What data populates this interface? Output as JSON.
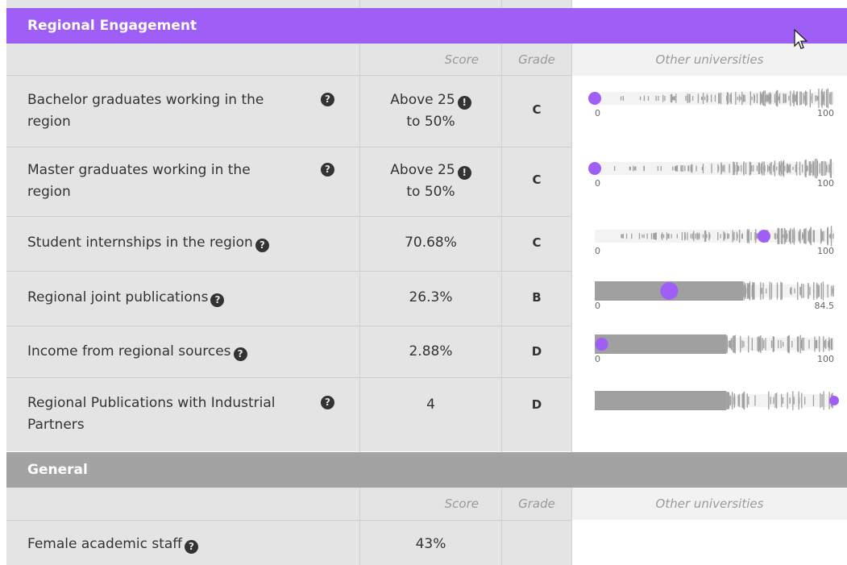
{
  "sections": {
    "regional": {
      "title": "Regional Engagement",
      "columns": {
        "score": "Score",
        "grade": "Grade",
        "other": "Other universities"
      },
      "rows": [
        {
          "label": "Bachelor graduates working in the region",
          "score_line1": "Above 25",
          "score_line2": "to 50%",
          "grade": "C",
          "dist_min": "0",
          "dist_max": "100",
          "marker_value": 0,
          "axis_max_value": 100
        },
        {
          "label": "Master graduates working in the region",
          "score_line1": "Above 25",
          "score_line2": "to 50%",
          "grade": "C",
          "dist_min": "0",
          "dist_max": "100",
          "marker_value": 0,
          "axis_max_value": 100
        },
        {
          "label": "Student internships in the region",
          "score": "70.68%",
          "grade": "C",
          "dist_min": "0",
          "dist_max": "100",
          "marker_value": 70.68,
          "axis_max_value": 100
        },
        {
          "label": "Regional joint publications",
          "score": "26.3%",
          "grade": "B",
          "dist_min": "0",
          "dist_max": "84.5",
          "marker_value": 26.3,
          "axis_max_value": 84.5
        },
        {
          "label": "Income from regional sources",
          "score": "2.88%",
          "grade": "D",
          "dist_min": "0",
          "dist_max": "100",
          "marker_value": 2.88,
          "axis_max_value": 100
        },
        {
          "label": "Regional Publications with Industrial Partners",
          "score": "4",
          "grade": "D",
          "dist_min": "",
          "dist_max": "",
          "marker_value": 100,
          "axis_max_value": 100
        }
      ]
    },
    "general": {
      "title": "General",
      "columns": {
        "score": "Score",
        "grade": "Grade",
        "other": "Other universities"
      },
      "rows": [
        {
          "label": "Female academic staff",
          "score": "43%",
          "grade": ""
        }
      ]
    }
  },
  "icons": {
    "help": "question-circle-icon",
    "warning": "exclamation-circle-icon",
    "cursor": "mouse-pointer-icon"
  },
  "colors": {
    "accent": "#9f5ff7",
    "section_gray": "#a3a3a3",
    "cell_bg": "#e4e4e4",
    "bar_gray": "#a0a0a0"
  }
}
